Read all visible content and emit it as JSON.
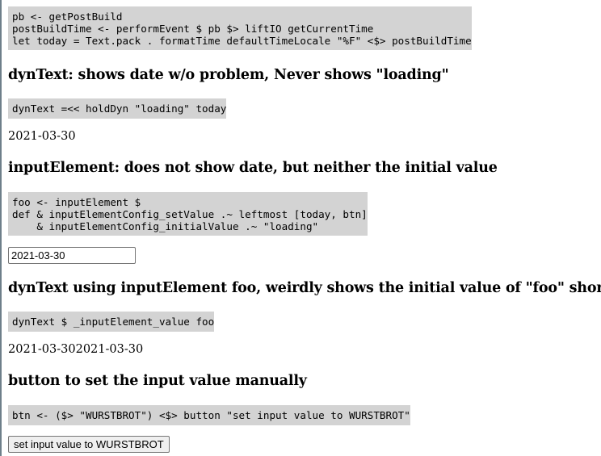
{
  "code_blocks": {
    "post_build": "pb <- getPostBuild\npostBuildTime <- performEvent $ pb $> liftIO getCurrentTime\nlet today = Text.pack . formatTime defaultTimeLocale \"%F\" <$> postBuildTime",
    "dyntext": "dynText =<< holdDyn \"loading\" today",
    "input_element": "foo <- inputElement $\ndef & inputElementConfig_setValue .~ leftmost [today, btn]\n    & inputElementConfig_initialValue .~ \"loading\"",
    "dyntext_input": "dynText $ _inputElement_value foo",
    "button": "btn <- ($> \"WURSTBROT\") <$> button \"set input value to WURSTBROT\""
  },
  "headings": {
    "dyntext": "dynText: shows date w/o problem, Never shows \"loading\"",
    "input_element": "inputElement: does not show date, but neither the initial value",
    "dyntext_input": "dynText using inputElement foo, weirdly shows the initial value of \"foo\" shortly",
    "button": "button to set the input value manually"
  },
  "outputs": {
    "dyntext_value": "2021-03-30",
    "input_value": "2021-03-30",
    "dyntext_input_value": "2021-03-302021-03-30",
    "button_label": "set input value to WURSTBROT"
  }
}
